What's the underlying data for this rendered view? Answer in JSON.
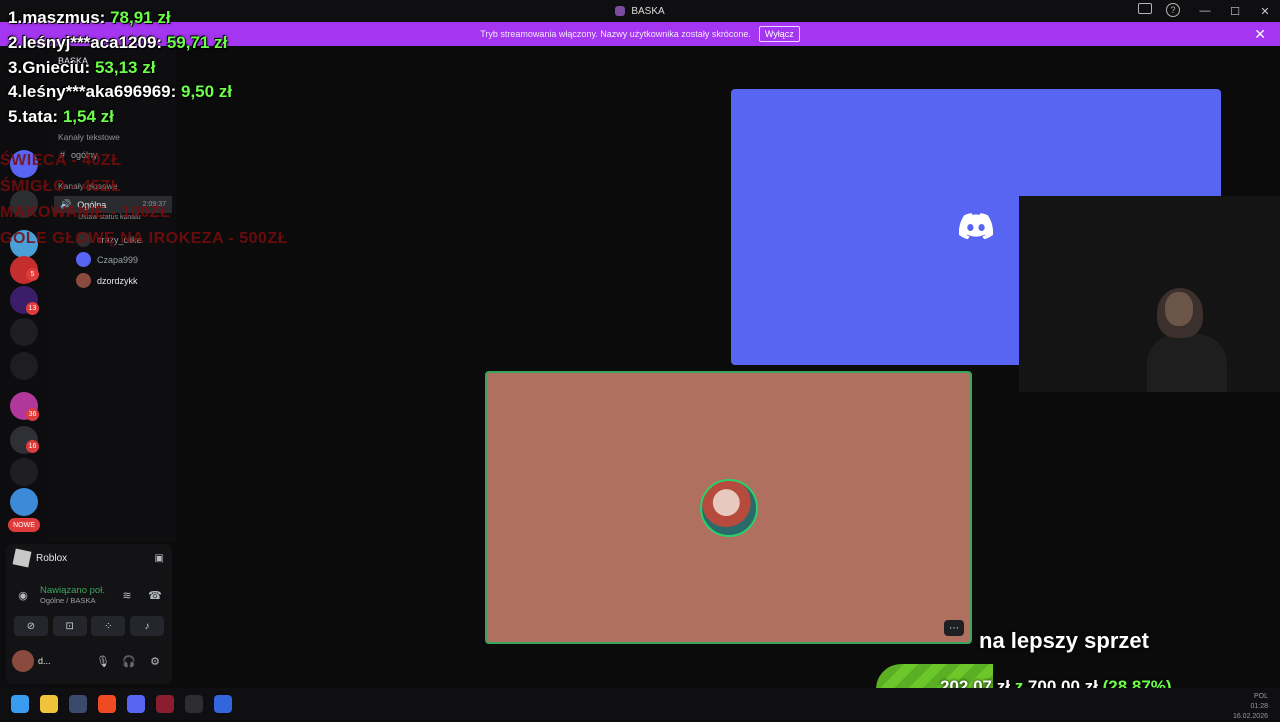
{
  "window": {
    "title": "BASKA"
  },
  "banner": {
    "text": "Tryb streamowania włączony. Nazwy użytkownika zostały skrócone.",
    "button": "Wyłącz"
  },
  "sidebar": {
    "server_name": "BASKA",
    "categories": {
      "text": "Kanały tekstowe",
      "voice": "Kanały głosowe"
    },
    "text_channel": "ogólny",
    "voice_channel": "Ogólna",
    "voice_timer": "2:09:37",
    "voice_status": "Ustaw status kanału",
    "members": [
      "crazy_clike",
      "Czapa999",
      "dzordzykk"
    ]
  },
  "rail_badges": [
    "5",
    "13",
    "36",
    "16"
  ],
  "rail_new": "NOWE",
  "user_panel": {
    "activity": "Roblox",
    "connection_status": "Nawiązano poł.",
    "connection_channel": "Ogólne / BASKA",
    "username": "d..."
  },
  "leaderboard": [
    {
      "rank": "1.",
      "name": "maszmus:",
      "amount": "78,91 zł"
    },
    {
      "rank": "2.",
      "name": "leśnyj***aca1209:",
      "amount": "59,71 zł"
    },
    {
      "rank": "3.",
      "name": "Gnieciu:",
      "amount": "53,13 zł"
    },
    {
      "rank": "4.",
      "name": "leśny***aka696969:",
      "amount": "9,50 zł"
    },
    {
      "rank": "5.",
      "name": "tata:",
      "amount": "1,54 zł"
    }
  ],
  "goals_overlay": [
    "ŚWIECA - 40ZŁ",
    "ŚMIGŁO - 45ZŁ",
    "MAKOWANIE - 100ZŁ",
    "GOLE GŁOWĘ NA IROKEZA - 500ZŁ"
  ],
  "donation_goal": {
    "title": "na lepszy sprzet",
    "current": "202,07 zł",
    "separator": "z",
    "target": "700,00 zł",
    "percent_text": "(28.87%)",
    "progress": 0.2887
  },
  "tray": {
    "lang": "POL",
    "time": "01:28",
    "date": "16.02.2026"
  },
  "colors": {
    "discord_blurple": "#5865f2",
    "banner": "#a435f0",
    "goal_green": "#6cff4a",
    "speaking_ring": "#3ba55c"
  }
}
